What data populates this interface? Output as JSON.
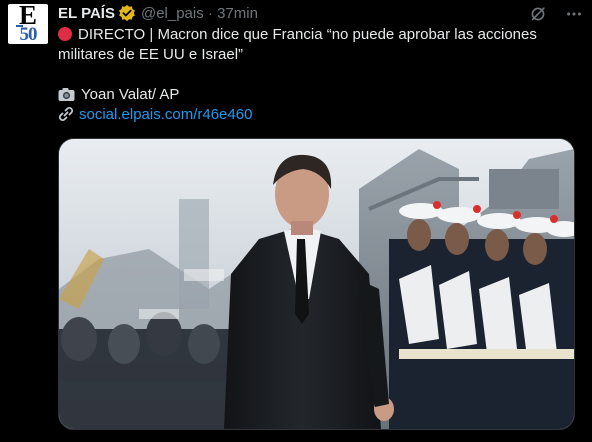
{
  "account": {
    "avatar_top": "E",
    "avatar_bottom": "50",
    "name": "EL PAÍS",
    "handle": "@el_pais",
    "separator": "·",
    "time": "37min"
  },
  "post": {
    "headline": "DIRECTO | Macron dice que Francia “no puede aprobar las acciones",
    "headline_cont": "militares de EE UU e Israel”",
    "credit": "Yoan Valat/ AP",
    "link": "social.elpais.com/r46e460"
  },
  "media": {
    "photo": "Emmanuel Macron in a dark suit walking past a line of sailors in white caps"
  },
  "colors": {
    "background": "#000000",
    "text": "#e7e9ea",
    "muted": "#71767b",
    "link": "#1d9bf0",
    "badge": "#e2b719",
    "live_dot": "#dd2e44"
  },
  "icons": {
    "verified": "verified-badge-icon",
    "grok": "grok-icon",
    "more": "more-options-icon",
    "live": "red-circle-icon",
    "camera": "camera-icon",
    "link": "link-icon"
  }
}
